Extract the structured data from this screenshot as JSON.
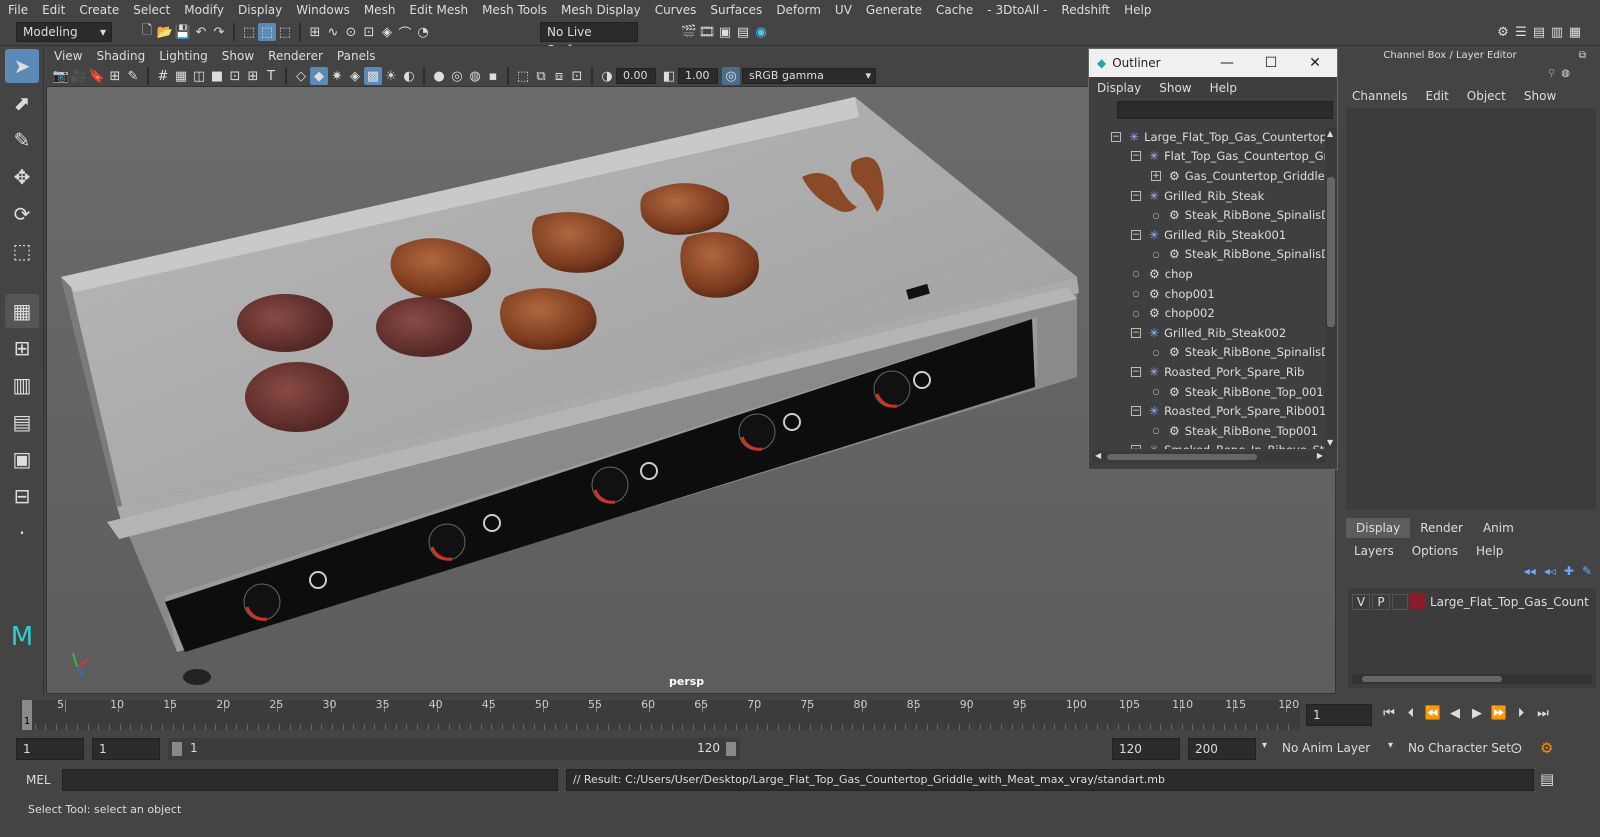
{
  "menubar": [
    "File",
    "Edit",
    "Create",
    "Select",
    "Modify",
    "Display",
    "Windows",
    "Mesh",
    "Edit Mesh",
    "Mesh Tools",
    "Mesh Display",
    "Curves",
    "Surfaces",
    "Deform",
    "UV",
    "Generate",
    "Cache",
    "- 3DtoAll -",
    "Redshift",
    "Help"
  ],
  "shelf": {
    "mode": "Modeling",
    "live_surface": "No Live Surface"
  },
  "viewport": {
    "menu": [
      "View",
      "Shading",
      "Lighting",
      "Show",
      "Renderer",
      "Panels"
    ],
    "exposure": "0.00",
    "gamma": "1.00",
    "color_space": "sRGB gamma",
    "camera_label": "persp"
  },
  "outliner": {
    "title": "Outliner",
    "menu": [
      "Display",
      "Show",
      "Help"
    ],
    "rows": [
      {
        "label": "Large_Flat_Top_Gas_Countertop_C",
        "depth": 0,
        "kind": "group",
        "exp": "minus"
      },
      {
        "label": "Flat_Top_Gas_Countertop_Gri",
        "depth": 1,
        "kind": "group",
        "exp": "minus"
      },
      {
        "label": "Gas_Countertop_Griddle",
        "depth": 2,
        "kind": "mesh",
        "exp": "plus"
      },
      {
        "label": "Grilled_Rib_Steak",
        "depth": 1,
        "kind": "group",
        "exp": "minus"
      },
      {
        "label": "Steak_RibBone_SpinalisDc",
        "depth": 2,
        "kind": "mesh",
        "exp": "dot"
      },
      {
        "label": "Grilled_Rib_Steak001",
        "depth": 1,
        "kind": "group",
        "exp": "minus"
      },
      {
        "label": "Steak_RibBone_SpinalisDc",
        "depth": 2,
        "kind": "mesh",
        "exp": "dot"
      },
      {
        "label": "chop",
        "depth": 1,
        "kind": "mesh",
        "exp": "dot"
      },
      {
        "label": "chop001",
        "depth": 1,
        "kind": "mesh",
        "exp": "dot"
      },
      {
        "label": "chop002",
        "depth": 1,
        "kind": "mesh",
        "exp": "dot"
      },
      {
        "label": "Grilled_Rib_Steak002",
        "depth": 1,
        "kind": "group",
        "exp": "minus"
      },
      {
        "label": "Steak_RibBone_SpinalisDc",
        "depth": 2,
        "kind": "mesh",
        "exp": "dot"
      },
      {
        "label": "Roasted_Pork_Spare_Rib",
        "depth": 1,
        "kind": "group",
        "exp": "minus"
      },
      {
        "label": "Steak_RibBone_Top_001",
        "depth": 2,
        "kind": "mesh",
        "exp": "dot"
      },
      {
        "label": "Roasted_Pork_Spare_Rib001",
        "depth": 1,
        "kind": "group",
        "exp": "minus"
      },
      {
        "label": "Steak_RibBone_Top001",
        "depth": 2,
        "kind": "mesh",
        "exp": "dot"
      },
      {
        "label": "Smoked_Bone_In_Ribeye_Stea",
        "depth": 1,
        "kind": "group",
        "exp": "minus"
      }
    ]
  },
  "channelbox": {
    "title": "Channel Box / Layer Editor",
    "menu": [
      "Channels",
      "Edit",
      "Object",
      "Show"
    ]
  },
  "layers": {
    "tabs": [
      "Display",
      "Render",
      "Anim"
    ],
    "menu": [
      "Layers",
      "Options",
      "Help"
    ],
    "layer": {
      "v": "V",
      "p": "P",
      "name": "Large_Flat_Top_Gas_Count",
      "color": "#8b1a2b"
    }
  },
  "timeline": {
    "ticks": [
      "5",
      "10",
      "15",
      "20",
      "25",
      "30",
      "35",
      "40",
      "45",
      "50",
      "55",
      "60",
      "65",
      "70",
      "75",
      "80",
      "85",
      "90",
      "95",
      "100",
      "105",
      "110",
      "115",
      "120"
    ],
    "current_frame_marker": "1",
    "current_frame": "1"
  },
  "range": {
    "start": "1",
    "playback_start": "1",
    "slider_start": "1",
    "slider_end": "120",
    "playback_end": "120",
    "end": "200",
    "anim_layer": "No Anim Layer",
    "character_set": "No Character Set"
  },
  "command": {
    "lang": "MEL",
    "result": "// Result: C:/Users/User/Desktop/Large_Flat_Top_Gas_Countertop_Griddle_with_Meat_max_vray/standart.mb"
  },
  "help_line": "Select Tool: select an object"
}
